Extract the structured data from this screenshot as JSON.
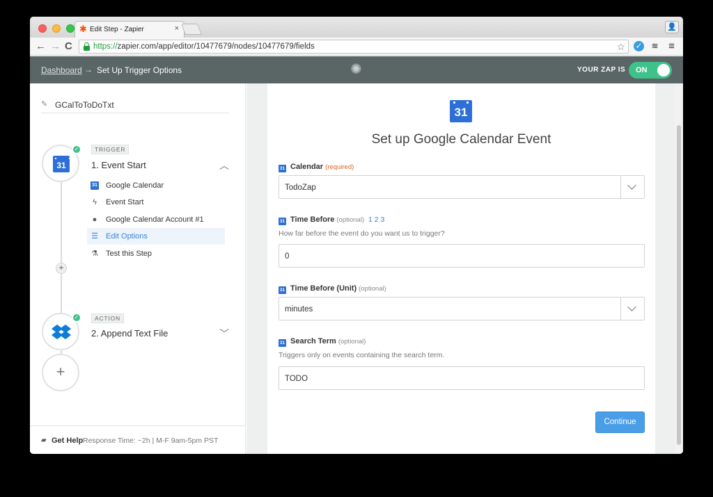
{
  "browser": {
    "tab_title": "Edit Step - Zapier",
    "tab_close": "×",
    "url_scheme": "https://",
    "url_rest": "zapier.com/app/editor/10477679/nodes/10477679/fields"
  },
  "header": {
    "dashboard_link": "Dashboard",
    "arrow": "→",
    "current_page": "Set Up Trigger Options",
    "zap_status_label": "YOUR ZAP IS",
    "toggle_label": "ON"
  },
  "sidebar": {
    "zap_name": "GCalToToDoTxt",
    "trigger": {
      "tag": "TRIGGER",
      "title": "1. Event Start",
      "icon_text": "31",
      "substeps": [
        {
          "label": "Google Calendar",
          "icon": "google-calendar-icon"
        },
        {
          "label": "Event Start",
          "icon": "lightning-icon"
        },
        {
          "label": "Google Calendar Account #1",
          "icon": "user-icon"
        },
        {
          "label": "Edit Options",
          "icon": "list-icon"
        },
        {
          "label": "Test this Step",
          "icon": "flask-icon"
        }
      ]
    },
    "action": {
      "tag": "ACTION",
      "title": "2. Append Text File"
    },
    "help": {
      "link": "Get Help",
      "text": "Response Time: ~2h | M-F 9am-5pm PST"
    }
  },
  "form": {
    "icon_text": "31",
    "heading": "Set up Google Calendar Event",
    "fields": {
      "calendar": {
        "label": "Calendar",
        "tag": "(required)",
        "value": "TodoZap"
      },
      "time_before": {
        "label": "Time Before",
        "tag": "(optional)",
        "extra": "1 2 3",
        "help": "How far before the event do you want us to trigger?",
        "value": "0"
      },
      "time_unit": {
        "label": "Time Before (Unit)",
        "tag": "(optional)",
        "value": "minutes"
      },
      "search_term": {
        "label": "Search Term",
        "tag": "(optional)",
        "help": "Triggers only on events containing the search term.",
        "value": "TODO"
      }
    },
    "continue_label": "Continue"
  },
  "colors": {
    "accent": "#4a9ee8",
    "header_bg": "#5a6566",
    "toggle_on": "#3fc18a",
    "required": "#e05e1e",
    "gcal_blue": "#2d6fd6"
  }
}
